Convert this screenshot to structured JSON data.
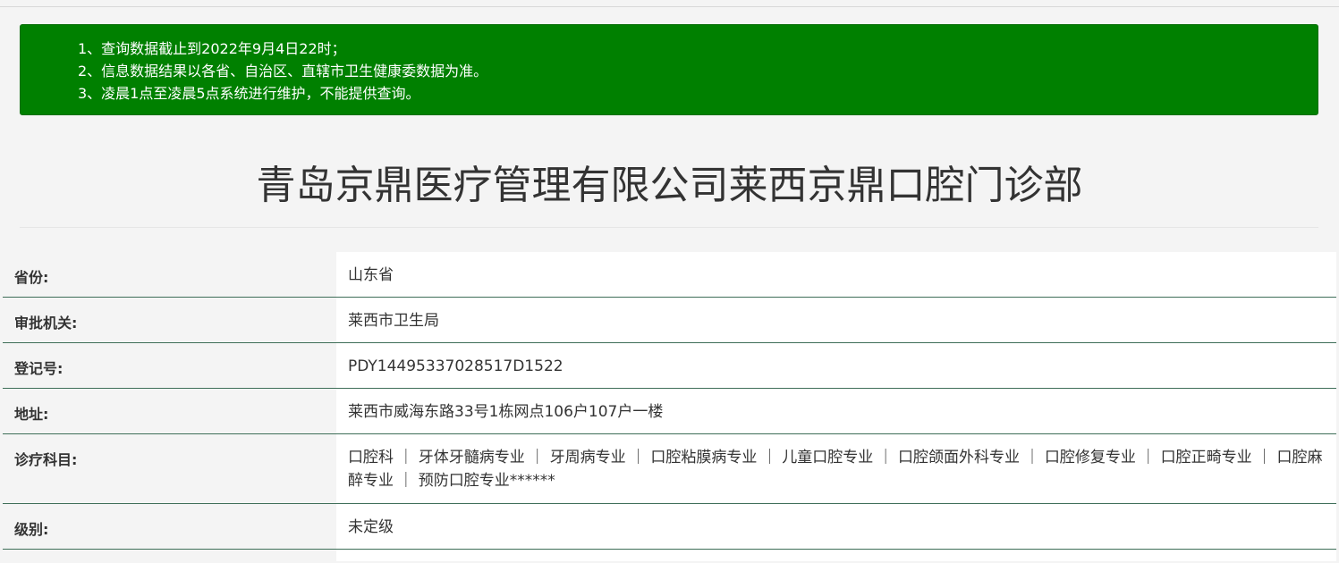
{
  "notice": {
    "lines": [
      "1、查询数据截止到2022年9月4日22时；",
      "2、信息数据结果以各省、自治区、直辖市卫生健康委数据为准。",
      "3、凌晨1点至凌晨5点系统进行维护，不能提供查询。"
    ]
  },
  "title": "青岛京鼎医疗管理有限公司莱西京鼎口腔门诊部",
  "rows": [
    {
      "label": "省份:",
      "value": "山东省"
    },
    {
      "label": "审批机关:",
      "value": "莱西市卫生局"
    },
    {
      "label": "登记号:",
      "value": "PDY14495337028517D1522"
    },
    {
      "label": "地址:",
      "value": "莱西市威海东路33号1栋网点106户107户一楼"
    },
    {
      "label": "诊疗科目:",
      "value": "口腔科 ｜ 牙体牙髓病专业 ｜ 牙周病专业 ｜ 口腔粘膜病专业 ｜ 儿童口腔专业 ｜ 口腔颌面外科专业 ｜ 口腔修复专业 ｜ 口腔正畸专业 ｜ 口腔麻醉专业 ｜ 预防口腔专业******"
    },
    {
      "label": "级别:",
      "value": "未定级"
    }
  ],
  "colors": {
    "notice_bg": "#008000",
    "row_rule": "#3e6e58"
  }
}
